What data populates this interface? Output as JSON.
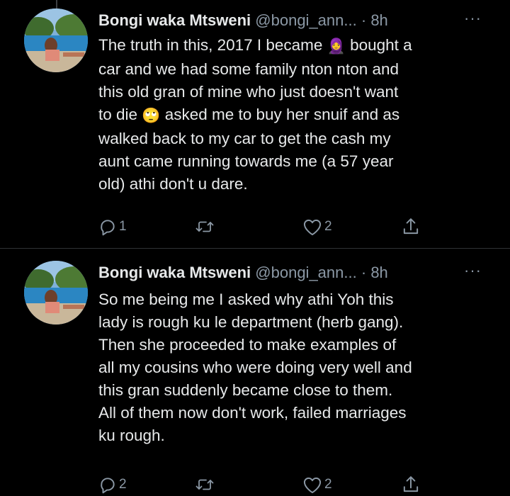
{
  "tweets": [
    {
      "name": "Bongi waka Mtsweni",
      "handle": "@bongi_ann...",
      "separator": "·",
      "time": "8h",
      "more": "···",
      "lines": [
        {
          "text": "The truth in this, 2017 I became ",
          "emoji": "🧕",
          "tail": " bought a"
        },
        {
          "text": "car and  we had some family nton nton and"
        },
        {
          "text": "this old gran of mine who just doesn't want"
        },
        {
          "text": "to die ",
          "emoji": "🙄",
          "tail": " asked me to buy her snuif and as"
        },
        {
          "text": "walked back to my car to get the cash my"
        },
        {
          "text": "aunt came running towards me (a 57 year"
        },
        {
          "text": "old) athi don't u dare."
        }
      ],
      "replies": "1",
      "retweets": "",
      "likes": "2"
    },
    {
      "name": "Bongi waka Mtsweni",
      "handle": "@bongi_ann...",
      "separator": "·",
      "time": "8h",
      "more": "···",
      "lines": [
        {
          "text": "So me being me I asked why athi Yoh this"
        },
        {
          "text": "lady is rough ku le department (herb gang)."
        },
        {
          "text": "Then she proceeded to make examples of"
        },
        {
          "text": "all my cousins who were doing very well and"
        },
        {
          "text": "this gran suddenly became close to them."
        },
        {
          "text": "All of them now don't work, failed marriages"
        },
        {
          "text": "ku rough."
        }
      ],
      "replies": "2",
      "retweets": "",
      "likes": "2"
    }
  ],
  "icons": {
    "reply": "reply-icon",
    "retweet": "retweet-icon",
    "like": "like-icon",
    "share": "share-icon",
    "more": "more-icon"
  },
  "colors": {
    "background": "#000000",
    "text": "#e7e9ea",
    "secondary": "#8b98a5",
    "divider": "#2f3336"
  }
}
